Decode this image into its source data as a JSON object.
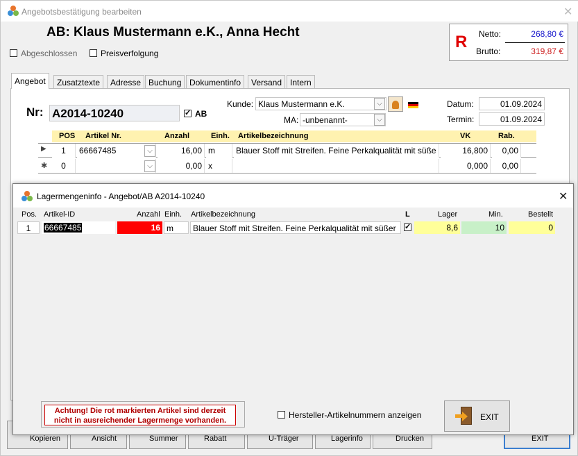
{
  "window": {
    "title": "Angebotsbestätigung bearbeiten"
  },
  "header": {
    "name": "AB: Klaus Mustermann e.K., Anna Hecht",
    "abgeschlossen_label": "Abgeschlossen",
    "preisverfolgung_label": "Preisverfolgung"
  },
  "totals": {
    "letter": "R",
    "netto_label": "Netto:",
    "netto_value": "268,80 €",
    "brutto_label": "Brutto:",
    "brutto_value": "319,87 €",
    "colors": {
      "netto": "#1a1acc",
      "brutto": "#cc1a1a",
      "letter": "#e00000"
    }
  },
  "tabs": [
    "Angebot",
    "Zusatztexte",
    "Adresse",
    "Buchung",
    "Dokumentinfo",
    "Versand",
    "Intern"
  ],
  "form": {
    "nr_label": "Nr:",
    "nr_value": "A2014-10240",
    "ab_label": "AB",
    "kunde_label": "Kunde:",
    "kunde_value": "Klaus Mustermann e.K.",
    "ma_label": "MA:",
    "ma_value": "-unbenannt-",
    "datum_label": "Datum:",
    "datum_value": "01.09.2024",
    "termin_label": "Termin:",
    "termin_value": "01.09.2024"
  },
  "grid": {
    "columns": [
      "POS",
      "Artikel Nr.",
      "Anzahl",
      "Einh.",
      "Artikelbezeichnung",
      "VK",
      "Rab."
    ],
    "rows": [
      {
        "marker": "▶",
        "pos": "1",
        "artikel": "66667485",
        "anzahl": "16,00",
        "einh": "m",
        "bez": "Blauer Stoff mit Streifen. Feine Perkalqualität mit süße",
        "vk": "16,800",
        "rab": "0,00"
      },
      {
        "marker": "✱",
        "pos": "0",
        "artikel": "",
        "anzahl": "0,00",
        "einh": "x",
        "bez": "",
        "vk": "0,000",
        "rab": "0,00"
      }
    ]
  },
  "bottom_buttons": [
    "Kopieren",
    "Ansicht",
    "Summer",
    "Rabatt",
    "U-Träger",
    "Lagerinfo",
    "Drucken",
    "EXIT"
  ],
  "dialog": {
    "title": "Lagermengeninfo - Angebot/AB A2014-10240",
    "columns": [
      "Pos.",
      "Artikel-ID",
      "Anzahl",
      "Einh.",
      "Artikelbezeichnung",
      "L",
      "Lager",
      "Min.",
      "Bestellt"
    ],
    "row": {
      "pos": "1",
      "artikel_id": "66667485",
      "anzahl": "16",
      "einh": "m",
      "bez": "Blauer Stoff mit Streifen. Feine Perkalqualität mit süßer",
      "lager": "8,6",
      "min": "10",
      "bestellt": "0"
    },
    "colors": {
      "anzahl_bg": "#ff0000",
      "lager_bg": "#ffff99",
      "min_bg": "#c8f0c8",
      "bestellt_bg": "#ffff99"
    },
    "warning": "Achtung! Die rot markierten Artikel sind derzeit nicht in ausreichender Lagermenge vorhanden.",
    "hersteller_label": "Hersteller-Artikelnummern anzeigen",
    "exit_label": "EXIT"
  }
}
